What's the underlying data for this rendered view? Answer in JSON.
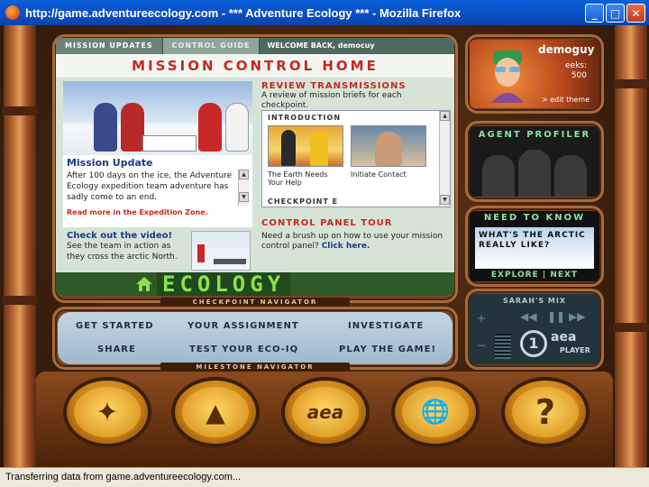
{
  "window": {
    "title": "http://game.adventureecology.com - *** Adventure Ecology *** - Mozilla Firefox",
    "minimize": "_",
    "maximize": "□",
    "close": "✕"
  },
  "status_bar": "Transferring data from game.adventureecology.com...",
  "tabs": [
    "MISSION UPDATES",
    "CONTROL GUIDE"
  ],
  "welcome": "WELCOME BACK, democuy",
  "page_title": "MISSION CONTROL HOME",
  "mission_update": {
    "title": "Mission Update",
    "body": "After 100 days on the ice, the Adventure Ecology expedition team adventure has sadly come to an end.",
    "link": "Read more in the Expedition Zone."
  },
  "video": {
    "title": "Check out the video!",
    "body": "See the team in action as they cross the arctic North."
  },
  "review": {
    "title": "REVIEW TRANSMISSIONS",
    "body": "A review of mission briefs for each checkpoint.",
    "box_head": "INTRODUCTION",
    "card1_caption": "The Earth Needs Your Help",
    "card2_caption": "Initiate Contact",
    "next_head": "CHECKPOINT E"
  },
  "control_panel": {
    "title": "CONTROL PANEL TOUR",
    "body": "Need a brush up on how to use your mission control panel?",
    "link": "Click here."
  },
  "logo": "ECOLOGY",
  "checkpoint_navigator": "CHECKPOINT NAVIGATOR",
  "milestones": {
    "get_started": "GET STARTED",
    "your_assignment": "YOUR ASSIGNMENT",
    "investigate": "INVESTIGATE",
    "share": "SHARE",
    "test_eco_iq": "TEST YOUR ECO-IQ",
    "play_game": "PLAY THE GAME!"
  },
  "milestone_navigator": "MILESTONE NAVIGATOR",
  "profile": {
    "username": "demoguy",
    "eeks_label": "eeks:",
    "eeks_value": "500",
    "edit_theme": "> edit theme"
  },
  "agent_profiler": "AGENT PROFILER",
  "need_to_know": {
    "head": "NEED TO KNOW",
    "question": "WHAT'S THE ARCTIC REALLY LIKE?",
    "explore": "EXPLORE",
    "next": "NEXT",
    "separator": "|"
  },
  "player": {
    "head": "SARAH'S MIX",
    "disc": "1",
    "logo": "aea",
    "label": "PLAYER",
    "plus": "+",
    "minus": "−",
    "rewind": "◀◀",
    "pause": "❚❚",
    "forward": "▶▶"
  },
  "console_buttons": {
    "compass": "✦",
    "triangle": "▲",
    "aea": "aea",
    "world": "🌐",
    "help": "?"
  },
  "colors": {
    "accent_red": "#c8281e",
    "link_blue": "#1a3a8a",
    "logo_green": "#8fe04a"
  }
}
